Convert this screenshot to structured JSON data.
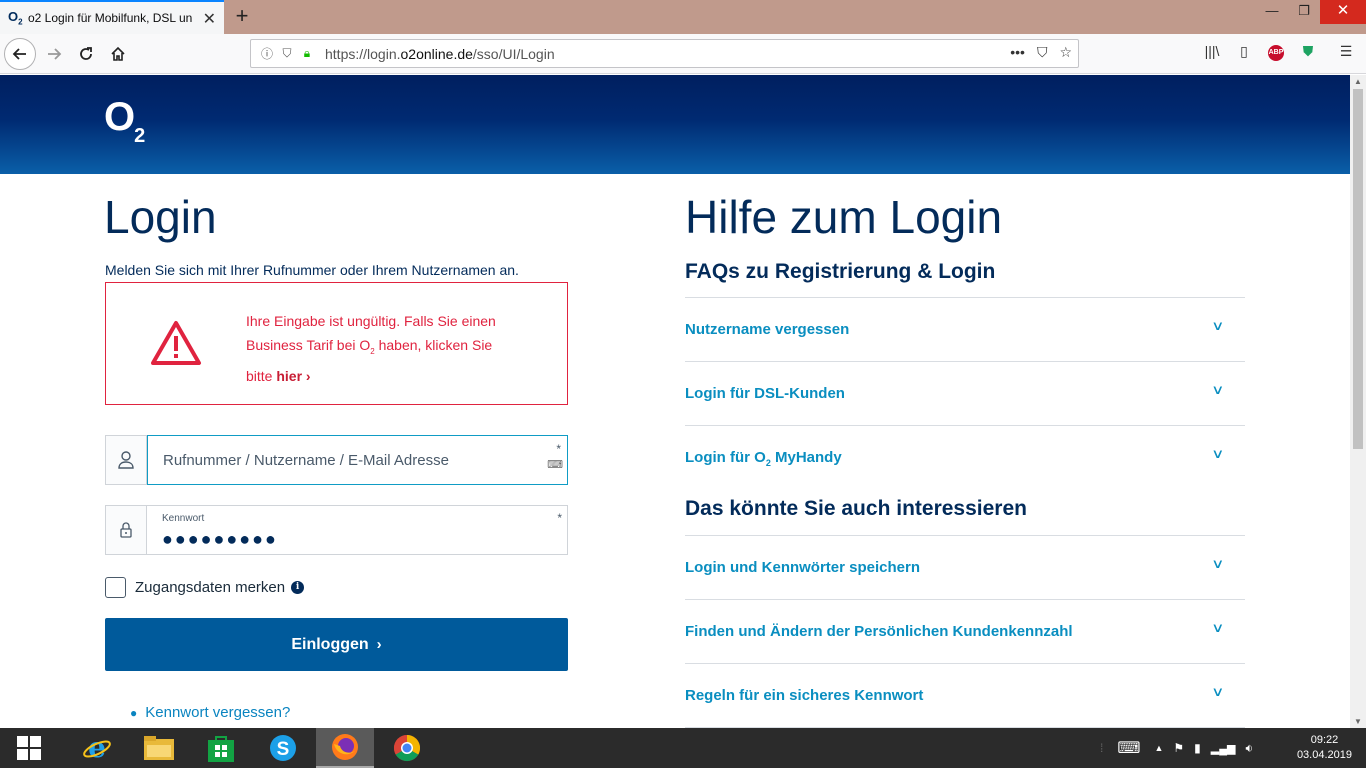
{
  "browser": {
    "tab_title": "o2 Login für Mobilfunk, DSL un",
    "tab_favicon": "O",
    "tab_favicon_sub": "2",
    "new_tab": "+",
    "url_prefix": "https://login.",
    "url_domain": "o2online.de",
    "url_path": "/sso/UI/Login",
    "url_menu": "•••"
  },
  "header": {
    "logo_o": "O",
    "logo_2": "2"
  },
  "login": {
    "title": "Login",
    "subtitle": "Melden Sie sich mit Ihrer Rufnummer oder Ihrem Nutzernamen an.",
    "error_line1": "Ihre Eingabe ist ungültig. Falls Sie einen",
    "error_line2a": "Business Tarif bei O",
    "error_line2_sub": "2",
    "error_line2b": " haben, klicken Sie",
    "error_line3": "bitte ",
    "error_link": "hier",
    "username_placeholder": "Rufnummer / Nutzername / E-Mail Adresse",
    "required_mark": "*",
    "password_label": "Kennwort",
    "password_value": "●●●●●●●●●",
    "remember_label": "Zugangsdaten merken",
    "info_glyph": "i",
    "submit_label": "Einloggen",
    "forgot_label": "Kennwort vergessen?"
  },
  "help": {
    "title": "Hilfe zum Login",
    "faq_heading": "FAQs zu Registrierung & Login",
    "faqs": [
      {
        "label": "Nutzername vergessen"
      },
      {
        "label": "Login für DSL-Kunden"
      },
      {
        "label_a": "Login für O",
        "label_sub": "2",
        "label_b": " MyHandy"
      }
    ],
    "interest_heading": "Das könnte Sie auch interessieren",
    "interests": [
      {
        "label": "Login und Kennwörter speichern"
      },
      {
        "label": "Finden und Ändern der Persönlichen Kundenkennzahl"
      },
      {
        "label": "Regeln für ein sicheres Kennwort"
      }
    ]
  },
  "taskbar": {
    "time": "09:22",
    "date": "03.04.2019"
  },
  "colors": {
    "brand_navy": "#032b5a",
    "link_blue": "#0a8ec0",
    "error_red": "#e0233f",
    "button_blue": "#005a9b"
  }
}
